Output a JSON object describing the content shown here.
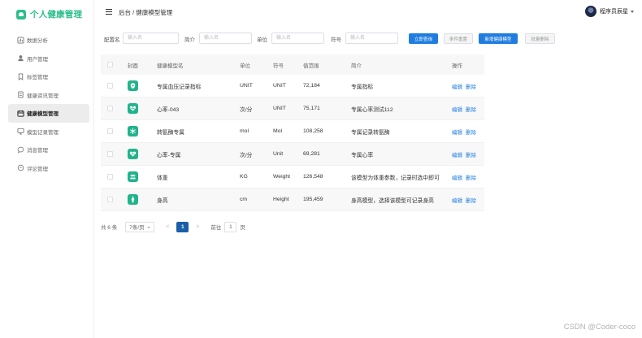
{
  "app": {
    "title": "个人健康管理"
  },
  "sidebar": {
    "items": [
      {
        "label": "数据分析",
        "icon": "chart-icon",
        "active": false
      },
      {
        "label": "用户管理",
        "icon": "user-icon",
        "active": false
      },
      {
        "label": "标签管理",
        "icon": "bookmark-icon",
        "active": false
      },
      {
        "label": "健康资讯管理",
        "icon": "document-icon",
        "active": false
      },
      {
        "label": "健康模型管理",
        "icon": "calendar-icon",
        "active": true
      },
      {
        "label": "模型记录管理",
        "icon": "monitor-icon",
        "active": false
      },
      {
        "label": "消息管理",
        "icon": "chat-icon",
        "active": false
      },
      {
        "label": "评论管理",
        "icon": "comment-icon",
        "active": false
      }
    ]
  },
  "header": {
    "breadcrumb": "后台 / 健康模型管理",
    "user_name": "程序员辰星"
  },
  "filters": {
    "name_label": "配置名",
    "name_placeholder": "输入名",
    "intro_label": "简介",
    "intro_placeholder": "输入名",
    "unit_label": "单位",
    "unit_placeholder": "输入名",
    "symbol_label": "符号",
    "symbol_placeholder": "输入名",
    "search_button": "立即查询",
    "reset_button": "条件重置",
    "add_button": "新增健康模型",
    "batch_delete_button": "批量删除"
  },
  "table": {
    "headers": [
      "封面",
      "健康模型名",
      "单位",
      "符号",
      "值范围",
      "简介",
      "操作"
    ],
    "rows": [
      {
        "icon": "health-shield-icon",
        "name": "专属血压记录指标",
        "unit": "UNIT",
        "symbol": "UNIT",
        "range": "72,184",
        "intro": "专属指标",
        "edit": "编辑",
        "delete": "删除"
      },
      {
        "icon": "heart-rate-icon",
        "name": "心率-043",
        "unit": "次/分",
        "symbol": "UNIT",
        "range": "75,171",
        "intro": "专属心率测试112",
        "edit": "编辑",
        "delete": "删除"
      },
      {
        "icon": "snowflake-icon",
        "name": "转氨酶专属",
        "unit": "mol",
        "symbol": "Mol",
        "range": "108,258",
        "intro": "专属记录转氨酶",
        "edit": "编辑",
        "delete": "删除"
      },
      {
        "icon": "heart-rate-icon",
        "name": "心率-专属",
        "unit": "次/分",
        "symbol": "Unit",
        "range": "69,281",
        "intro": "专属心率",
        "edit": "编辑",
        "delete": "删除"
      },
      {
        "icon": "scale-icon",
        "name": "体重",
        "unit": "KG",
        "symbol": "Weight",
        "range": "126,548",
        "intro": "该模型为体重参数，记录时选中即可",
        "edit": "编辑",
        "delete": "删除"
      },
      {
        "icon": "person-icon",
        "name": "身高",
        "unit": "cm",
        "symbol": "Height",
        "range": "195,459",
        "intro": "身高模型，选择该模型可记录身高",
        "edit": "编辑",
        "delete": "删除"
      }
    ]
  },
  "pagination": {
    "total": "共 6 条",
    "page_size": "7条/页",
    "prev": "<",
    "current_page": "1",
    "next": ">",
    "goto_prefix": "前往",
    "goto_value": "1",
    "goto_suffix": "页"
  },
  "watermark": "CSDN @Coder-coco",
  "colors": {
    "brand": "#2bbf8a",
    "primary": "#1f7de0",
    "active_page": "#1a5fa8",
    "icon_bg": "#22b38c"
  }
}
